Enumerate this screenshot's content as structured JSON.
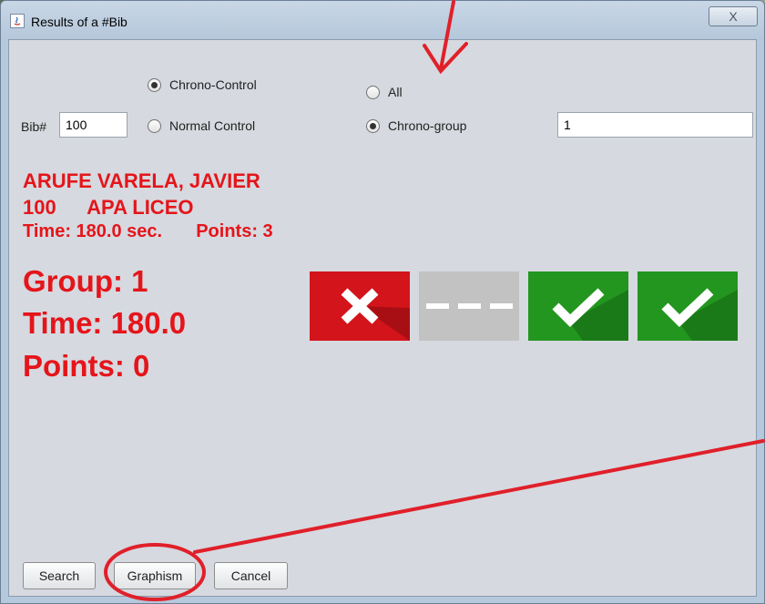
{
  "window": {
    "title": "Results of a #Bib",
    "close_glyph": "X",
    "icon": "java-app-icon"
  },
  "form": {
    "bib_label": "Bib#",
    "bib_value": "100",
    "control_options": [
      {
        "label": "Chrono-Control",
        "selected": true
      },
      {
        "label": "Normal Control",
        "selected": false
      }
    ],
    "group_options": [
      {
        "label": "All",
        "selected": false
      },
      {
        "label": "Chrono-group",
        "selected": true
      }
    ],
    "group_value": "1"
  },
  "result": {
    "name": "ARUFE VARELA, JAVIER",
    "bib": "100",
    "club": "APA LICEO",
    "time_line": "Time: 180.0 sec.",
    "points_line": "Points: 3",
    "group_line": "Group: 1",
    "big_time_line": "Time: 180.0",
    "big_points_line": "Points: 0",
    "controls": [
      {
        "status": "fail",
        "icon": "cross-icon",
        "color": "#d3141b"
      },
      {
        "status": "none",
        "icon": "dash-icon",
        "color": "#c2c2c2"
      },
      {
        "status": "ok",
        "icon": "check-icon",
        "color": "#23961f"
      },
      {
        "status": "ok",
        "icon": "check-icon",
        "color": "#23961f"
      }
    ]
  },
  "buttons": {
    "search": "Search",
    "graphism": "Graphism",
    "cancel": "Cancel"
  },
  "colors": {
    "result_text": "#e4151b",
    "annotation": "#e0202a"
  }
}
